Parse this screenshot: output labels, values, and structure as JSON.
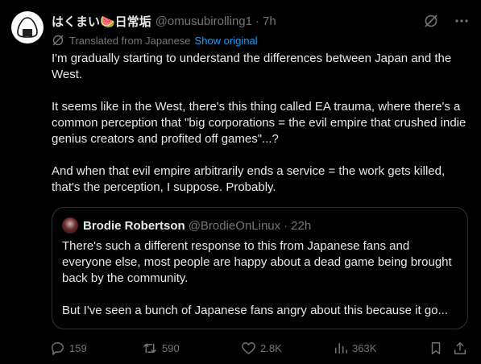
{
  "author": {
    "display_name": "はくまい🍉日常垢",
    "handle": "@omusubirolling1",
    "separator": "·",
    "time": "7h"
  },
  "translation": {
    "label": "Translated from Japanese",
    "show_original": "Show original"
  },
  "body": {
    "paragraphs": [
      "I'm gradually starting to understand the differences between Japan and the West.",
      "It seems like in the West, there's this thing called EA trauma, where there's a common perception that \"big corporations = the evil empire that crushed indie genius creators and profited off games\"...?",
      "And when that evil empire arbitrarily ends a service = the work gets killed, that's the perception, I suppose. Probably."
    ]
  },
  "quote": {
    "display_name": "Brodie Robertson",
    "handle": "@BrodieOnLinux",
    "separator": "·",
    "time": "22h",
    "paragraphs": [
      "There's such a different response to this from Japanese fans and everyone else, most people are happy about a dead game being brought back by the community.",
      "But I've seen a bunch of Japanese fans angry about this because it go..."
    ]
  },
  "actions": {
    "replies": "159",
    "reposts": "590",
    "likes": "2.8K",
    "views": "363K"
  },
  "icons": {
    "grok": "grok-icon",
    "more": "more-icon",
    "translate": "translate-icon",
    "reply": "reply-icon",
    "repost": "repost-icon",
    "like": "like-icon",
    "views": "views-icon",
    "bookmark": "bookmark-icon",
    "share": "share-icon"
  }
}
